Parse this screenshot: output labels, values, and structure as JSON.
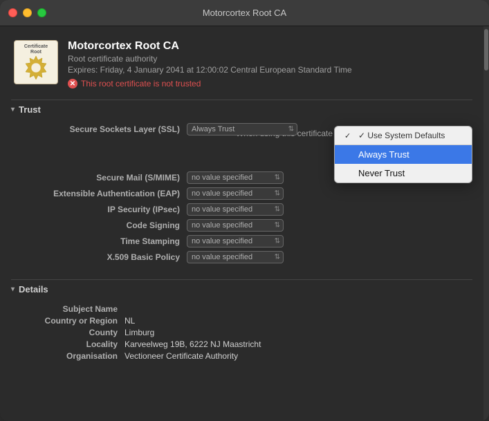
{
  "window": {
    "title": "Motorcortex Root CA"
  },
  "cert": {
    "name": "Motorcortex Root CA",
    "type": "Root certificate authority",
    "expires": "Expires: Friday, 4 January 2041 at 12:00:02 Central European Standard Time",
    "warning": "This root certificate is not trusted"
  },
  "trust_section": {
    "label": "Trust",
    "when_label": "When using this certificate",
    "help": "?"
  },
  "dropdown_menu": {
    "system_default": "✓ Use System Defaults",
    "always_trust": "Always Trust",
    "never_trust": "Never Trust"
  },
  "ssl_label": "Secure Sockets Layer (SSL)",
  "ssl_value": "Always Trust",
  "properties": [
    {
      "label": "Secure Mail (S/MIME)",
      "value": "no value specified"
    },
    {
      "label": "Extensible Authentication (EAP)",
      "value": "no value specified"
    },
    {
      "label": "IP Security (IPsec)",
      "value": "no value specified"
    },
    {
      "label": "Code Signing",
      "value": "no value specified"
    },
    {
      "label": "Time Stamping",
      "value": "no value specified"
    },
    {
      "label": "X.509 Basic Policy",
      "value": "no value specified"
    }
  ],
  "details_section": {
    "label": "Details"
  },
  "details": [
    {
      "label": "Subject Name",
      "value": ""
    },
    {
      "label": "Country or Region",
      "value": "NL"
    },
    {
      "label": "County",
      "value": "Limburg"
    },
    {
      "label": "Locality",
      "value": "Karveelweg 19B, 6222 NJ Maastricht"
    },
    {
      "label": "Organisation",
      "value": "Vectioneer Certificate Authority"
    }
  ]
}
